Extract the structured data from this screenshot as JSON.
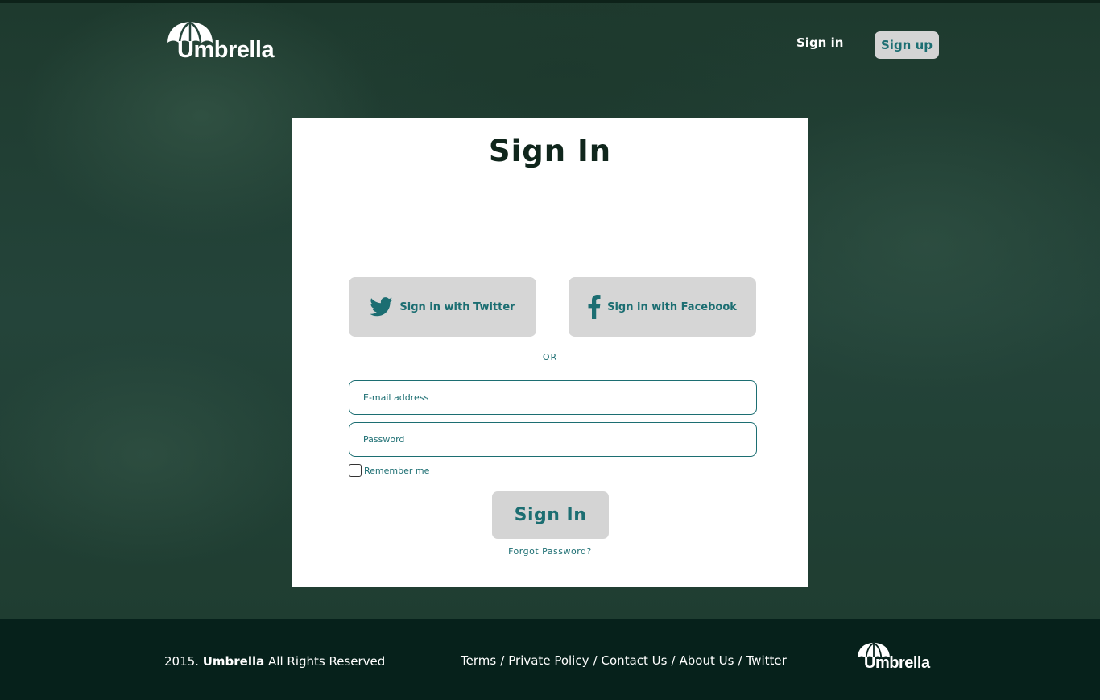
{
  "header": {
    "logo_text": "Umbrella",
    "nav_signin": "Sign in",
    "nav_signup": "Sign up"
  },
  "form": {
    "title": "Sign In",
    "twitter_button": "Sign in with Twitter",
    "facebook_button": "Sign in with Facebook",
    "or_label": "OR",
    "email_placeholder": "E-mail address",
    "email_value": "",
    "password_placeholder": "Password",
    "password_value": "",
    "remember_label": "Remember me",
    "remember_checked": false,
    "submit_label": "Sign In",
    "forgot_label": "Forgot Password?"
  },
  "footer": {
    "year": "2015.",
    "brand": "Umbrella",
    "rights": "All Rights Reserved",
    "links": [
      "Terms",
      "Private Policy",
      "Contact Us",
      "About Us",
      "Twitter"
    ],
    "separator": "/",
    "logo_text": "Umbrella"
  },
  "colors": {
    "accent": "#1c6e72",
    "background": "#1f3d30",
    "footer": "#06211b",
    "button_gray": "#d4d4d4"
  },
  "icons": [
    "umbrella-logo-icon",
    "twitter-bird-icon",
    "facebook-f-icon"
  ]
}
